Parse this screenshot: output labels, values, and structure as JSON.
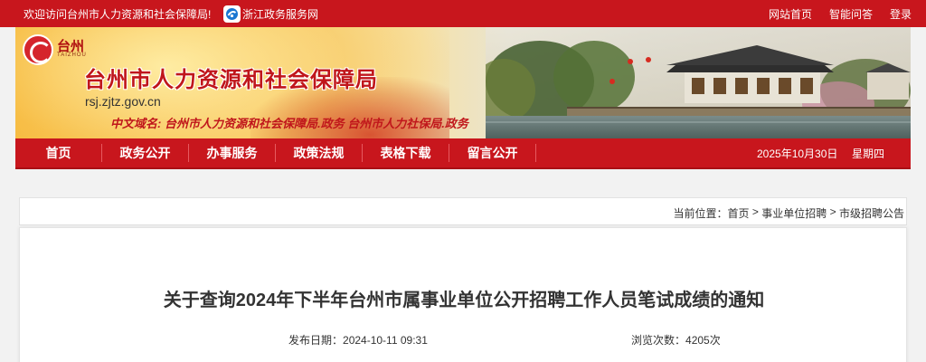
{
  "topbar": {
    "welcome": "欢迎访问台州市人力资源和社会保障局!",
    "gov_link": "浙江政务服务网",
    "links": [
      "网站首页",
      "智能问答",
      "登录"
    ]
  },
  "banner": {
    "logo_name": "台州",
    "logo_sub": "TAIZHOU",
    "title": "台州市人力资源和社会保障局",
    "domain": "rsj.zjtz.gov.cn",
    "cn_label": "中文域名:",
    "cn_domains": "台州市人力资源和社会保障局.政务  台州市人力社保局.政务"
  },
  "nav": {
    "items": [
      "首页",
      "政务公开",
      "办事服务",
      "政策法规",
      "表格下载",
      "留言公开"
    ],
    "date": "2025年10月30日",
    "weekday": "星期四"
  },
  "breadcrumb": {
    "prefix": "当前位置：",
    "items": [
      "首页",
      "事业单位招聘",
      "市级招聘公告"
    ],
    "separator": ">"
  },
  "article": {
    "title": "关于查询2024年下半年台州市属事业单位公开招聘工作人员笔试成绩的通知",
    "publish_label": "发布日期：",
    "publish_date": "2024-10-11 09:31",
    "views_label": "浏览次数：",
    "views": "4205次"
  },
  "colors": {
    "brand_red": "#c8161d",
    "page_bg": "#f2f2f2"
  }
}
